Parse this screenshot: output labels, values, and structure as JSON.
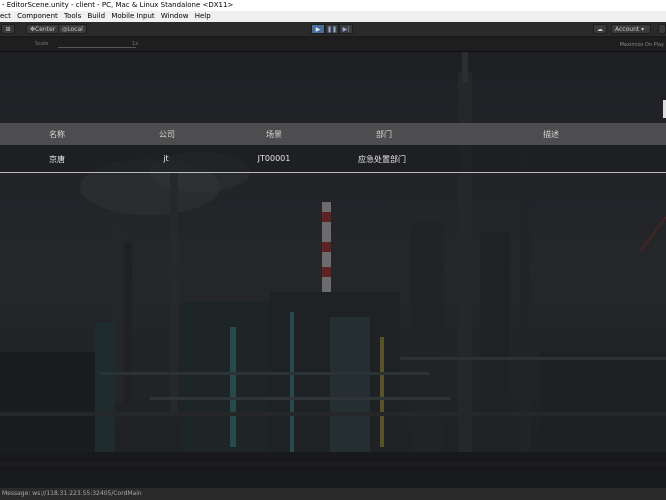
{
  "window": {
    "title": "- EditorScene.unity - client - PC, Mac & Linux Standalone <DX11>"
  },
  "menu": {
    "items": [
      "ect",
      "Component",
      "Tools",
      "Build",
      "Mobile Input",
      "Window",
      "Help"
    ]
  },
  "toolbar": {
    "center_label": "Center",
    "local_label": "Local",
    "account_label": "Account",
    "play_icon": "play-icon",
    "pause_icon": "pause-icon",
    "step_icon": "step-icon"
  },
  "game_view": {
    "scale_label": "Scale",
    "scale_value": "1x",
    "maximize_label": "Maximize On Play"
  },
  "table": {
    "headers": [
      "名称",
      "公司",
      "场景",
      "部门",
      "描述"
    ],
    "rows": [
      {
        "name": "京唐",
        "company": "jt",
        "scene": "JT00001",
        "department": "应急处置部门",
        "description": ""
      }
    ]
  },
  "status": {
    "message": "Message: ws://118.31.223.55:32405/CordMain"
  }
}
